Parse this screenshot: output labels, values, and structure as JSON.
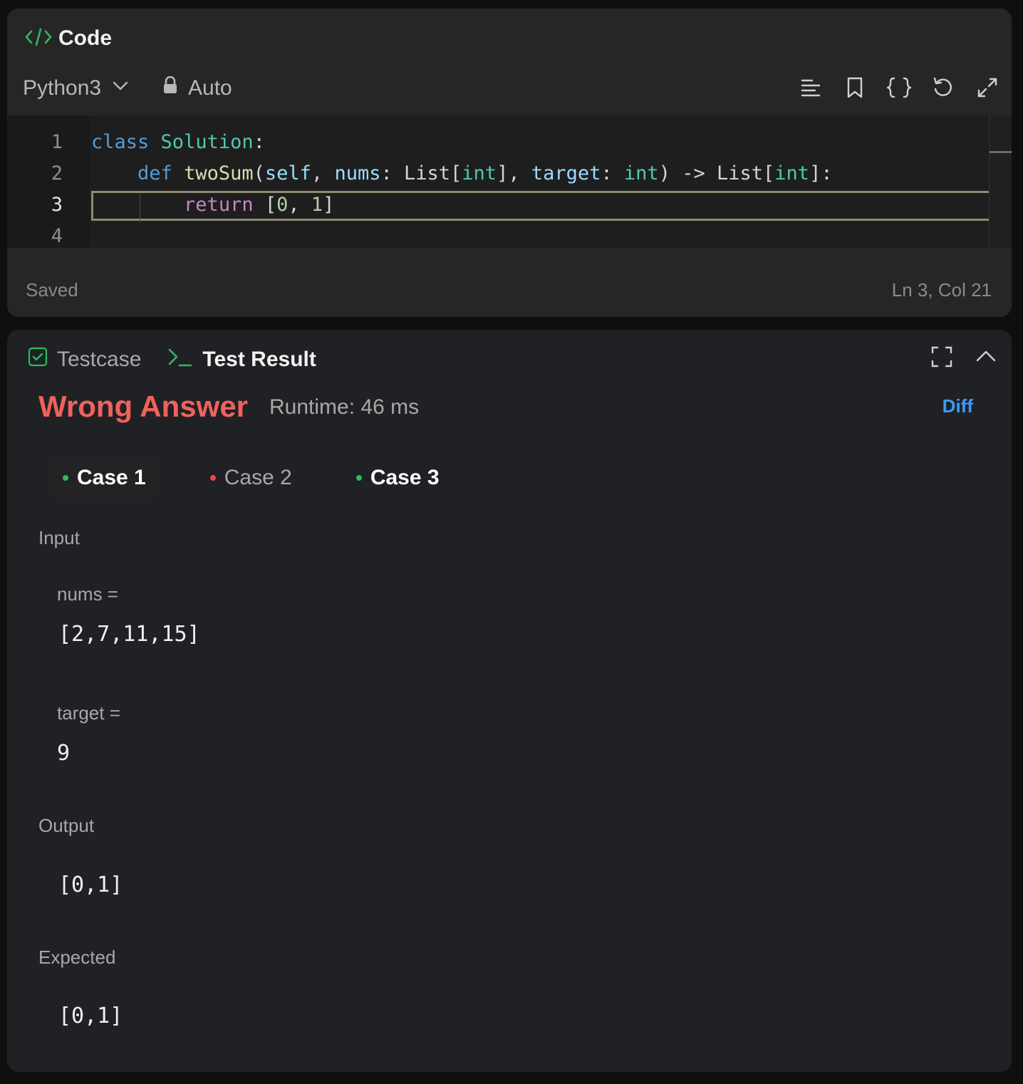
{
  "code_panel": {
    "title": "Code",
    "language": "Python3",
    "mode": "Auto",
    "toolbar_icons": [
      "format-lines-icon",
      "bookmark-icon",
      "braces-icon",
      "reset-icon",
      "expand-icon"
    ],
    "line_numbers": [
      "1",
      "2",
      "3",
      "4"
    ],
    "code": {
      "line1": {
        "kw": "class",
        "cls": "Solution",
        "rest": ":"
      },
      "line2": {
        "kw": "def",
        "fn": "twoSum",
        "p1": "self",
        "p2": "nums",
        "t1": "List",
        "t1b": "int",
        "p3": "target",
        "t2": "int",
        "arrow": "->",
        "t3": "List",
        "t3b": "int"
      },
      "line3": {
        "ctl": "return",
        "open": "[",
        "n1": "0",
        "sep": ", ",
        "n2": "1",
        "close": "]"
      }
    },
    "status": "Saved",
    "cursor_position": "Ln 3, Col 21"
  },
  "result_panel": {
    "tabs": [
      {
        "label": "Testcase",
        "icon": "checkbox-icon"
      },
      {
        "label": "Test Result",
        "icon": "terminal-icon"
      }
    ],
    "verdict": "Wrong Answer",
    "runtime": "Runtime: 46 ms",
    "diff_label": "Diff",
    "cases": [
      {
        "label": "Case 1",
        "status": "pass"
      },
      {
        "label": "Case 2",
        "status": "fail"
      },
      {
        "label": "Case 3",
        "status": "pass"
      }
    ],
    "input_label": "Input",
    "inputs": [
      {
        "name": "nums =",
        "value": "[2,7,11,15]"
      },
      {
        "name": "target =",
        "value": "9"
      }
    ],
    "output_label": "Output",
    "output_value": "[0,1]",
    "expected_label": "Expected",
    "expected_value": "[0,1]"
  },
  "colors": {
    "wrong_answer": "#f0625b",
    "pass_dot": "#2cbb5d",
    "fail_dot": "#ef4743",
    "accent_green": "#2cbb5d",
    "diff_link": "#3b9cff"
  }
}
